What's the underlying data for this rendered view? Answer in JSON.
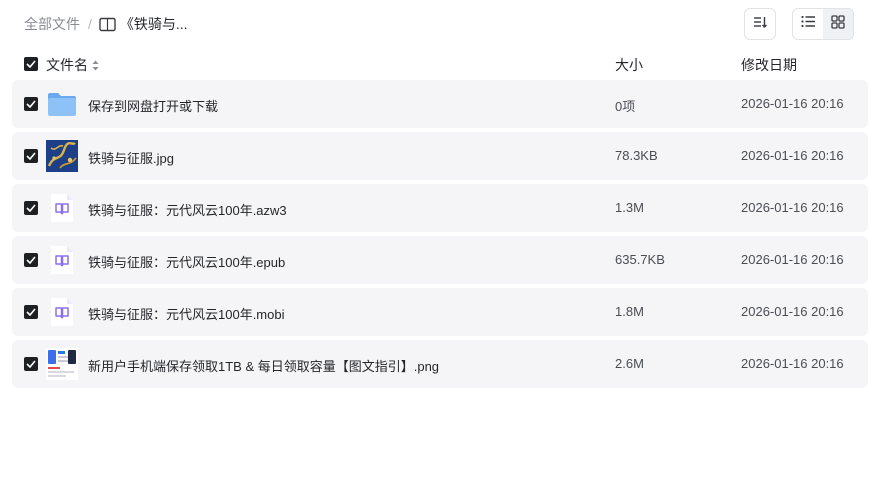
{
  "breadcrumb": {
    "root": "全部文件",
    "separator": "/",
    "current": "《铁骑与..."
  },
  "toolbar": {
    "sort_icon": "sort-icon",
    "list_view_icon": "list-view-icon",
    "grid_view_icon": "grid-view-icon"
  },
  "table": {
    "columns": {
      "name": "文件名",
      "size": "大小",
      "modified": "修改日期"
    },
    "rows": [
      {
        "name": "保存到网盘打开或下载",
        "size": "0项",
        "date": "2026-01-16 20:16",
        "icon": "folder-icon",
        "checked": true
      },
      {
        "name": "铁骑与征服.jpg",
        "size": "78.3KB",
        "date": "2026-01-16 20:16",
        "icon": "image-thumbnail",
        "checked": true
      },
      {
        "name": "铁骑与征服：元代风云100年.azw3",
        "size": "1.3M",
        "date": "2026-01-16 20:16",
        "icon": "ebook-icon",
        "checked": true
      },
      {
        "name": "铁骑与征服：元代风云100年.epub",
        "size": "635.7KB",
        "date": "2026-01-16 20:16",
        "icon": "ebook-icon",
        "checked": true
      },
      {
        "name": "铁骑与征服：元代风云100年.mobi",
        "size": "1.8M",
        "date": "2026-01-16 20:16",
        "icon": "ebook-icon",
        "checked": true
      },
      {
        "name": "新用户手机端保存领取1TB & 每日领取容量【图文指引】.png",
        "size": "2.6M",
        "date": "2026-01-16 20:16",
        "icon": "image-thumbnail",
        "checked": true
      }
    ]
  },
  "colors": {
    "row_bg": "#f5f5f7",
    "checkbox": "#1f2024",
    "folder": "#7fb8f5",
    "ebook_accent": "#8b6ef0"
  }
}
